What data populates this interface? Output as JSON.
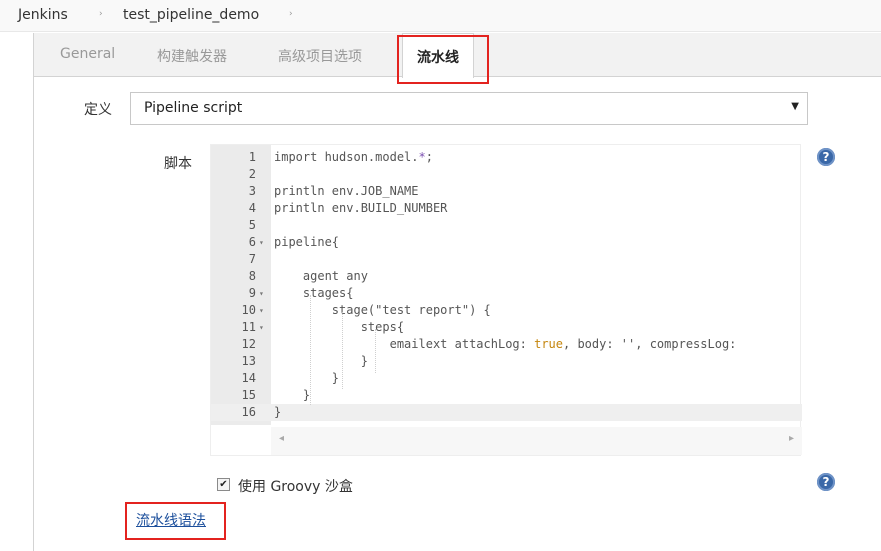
{
  "breadcrumb": {
    "items": [
      "Jenkins",
      "test_pipeline_demo"
    ],
    "separator": "›"
  },
  "tabs": [
    {
      "label": "General",
      "active": false
    },
    {
      "label": "构建触发器",
      "active": false
    },
    {
      "label": "高级项目选项",
      "active": false
    },
    {
      "label": "流水线",
      "active": true
    }
  ],
  "definition": {
    "label": "定义",
    "selected": "Pipeline script"
  },
  "script": {
    "label": "脚本",
    "lines": [
      {
        "n": "1",
        "fold": "",
        "text": "import hudson.model.*;"
      },
      {
        "n": "2",
        "fold": "",
        "text": ""
      },
      {
        "n": "3",
        "fold": "",
        "text": "println env.JOB_NAME"
      },
      {
        "n": "4",
        "fold": "",
        "text": "println env.BUILD_NUMBER"
      },
      {
        "n": "5",
        "fold": "",
        "text": ""
      },
      {
        "n": "6",
        "fold": "▾",
        "text": "pipeline{"
      },
      {
        "n": "7",
        "fold": "",
        "text": ""
      },
      {
        "n": "8",
        "fold": "",
        "text": "    agent any"
      },
      {
        "n": "9",
        "fold": "▾",
        "text": "    stages{"
      },
      {
        "n": "10",
        "fold": "▾",
        "text": "        stage(\"test report\") {"
      },
      {
        "n": "11",
        "fold": "▾",
        "text": "            steps{"
      },
      {
        "n": "12",
        "fold": "",
        "text": "                emailext attachLog: true, body: '', compressLog:"
      },
      {
        "n": "13",
        "fold": "",
        "text": "            }"
      },
      {
        "n": "14",
        "fold": "",
        "text": "        }"
      },
      {
        "n": "15",
        "fold": "",
        "text": "    }"
      },
      {
        "n": "16",
        "fold": "",
        "text": "}"
      }
    ],
    "active_line": "16"
  },
  "sandbox": {
    "checked": true,
    "label": "使用 Groovy 沙盒"
  },
  "syntax_link": "流水线语法",
  "help_icon": "?",
  "colors": {
    "highlight_red": "#e3231f",
    "help_blue": "#3a68a8",
    "keyword_true": "#c5860d",
    "link": "#1c4f9c"
  },
  "icons": [
    "help-icon",
    "checkbox-checked-icon",
    "dropdown-arrow-icon",
    "fold-arrow-icon",
    "scroll-left-icon",
    "scroll-right-icon"
  ]
}
